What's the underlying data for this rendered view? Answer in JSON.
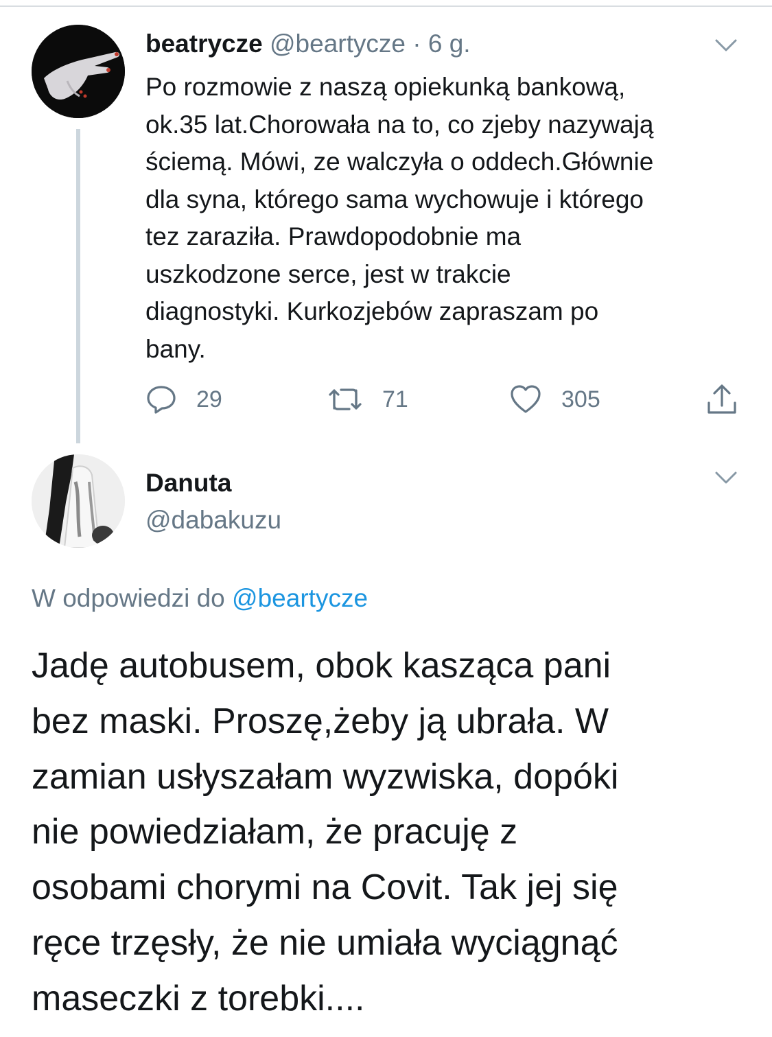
{
  "colors": {
    "text_primary": "#14171a",
    "text_secondary": "#657786",
    "link": "#1b95e0",
    "thread_line": "#ccd6dd"
  },
  "tweet1": {
    "display_name": "beatrycze",
    "handle": "@beartycze",
    "separator": "·",
    "time": "6 g.",
    "text": "Po rozmowie z naszą opiekunką bankową,\nok.35 lat.Chorowała na to, co zjeby nazywają\nściemą. Mówi, ze walczyła o oddech.Głównie\ndla syna, którego sama wychowuje i którego\ntez zaraziła. Prawdopodobnie ma\nuszkodzone serce, jest w trakcie\ndiagnostyki. Kurkozjebów zapraszam po\nbany.",
    "avatar_icon": "avatar-hand-image",
    "menu_icon": "chevron-down-icon",
    "actions": {
      "reply_count": "29",
      "retweet_count": "71",
      "like_count": "305",
      "reply_icon": "reply-icon",
      "retweet_icon": "retweet-icon",
      "like_icon": "heart-icon",
      "share_icon": "share-icon"
    }
  },
  "tweet2": {
    "display_name": "Danuta",
    "handle": "@dabakuzu",
    "avatar_icon": "avatar-figure-image",
    "menu_icon": "chevron-down-icon",
    "reply_prefix": "W odpowiedzi do",
    "reply_to": "@beartycze",
    "text": "Jadę autobusem, obok kasząca pani\nbez maski. Proszę,żeby ją ubrała. W\nzamian usłyszałam wyzwiska, dopóki\nnie powiedziałam, że pracuję z\nosobami chorymi na Covit. Tak jej się\nręce trzęsły, że nie umiała wyciągnąć\nmaseczki z torebki...."
  }
}
